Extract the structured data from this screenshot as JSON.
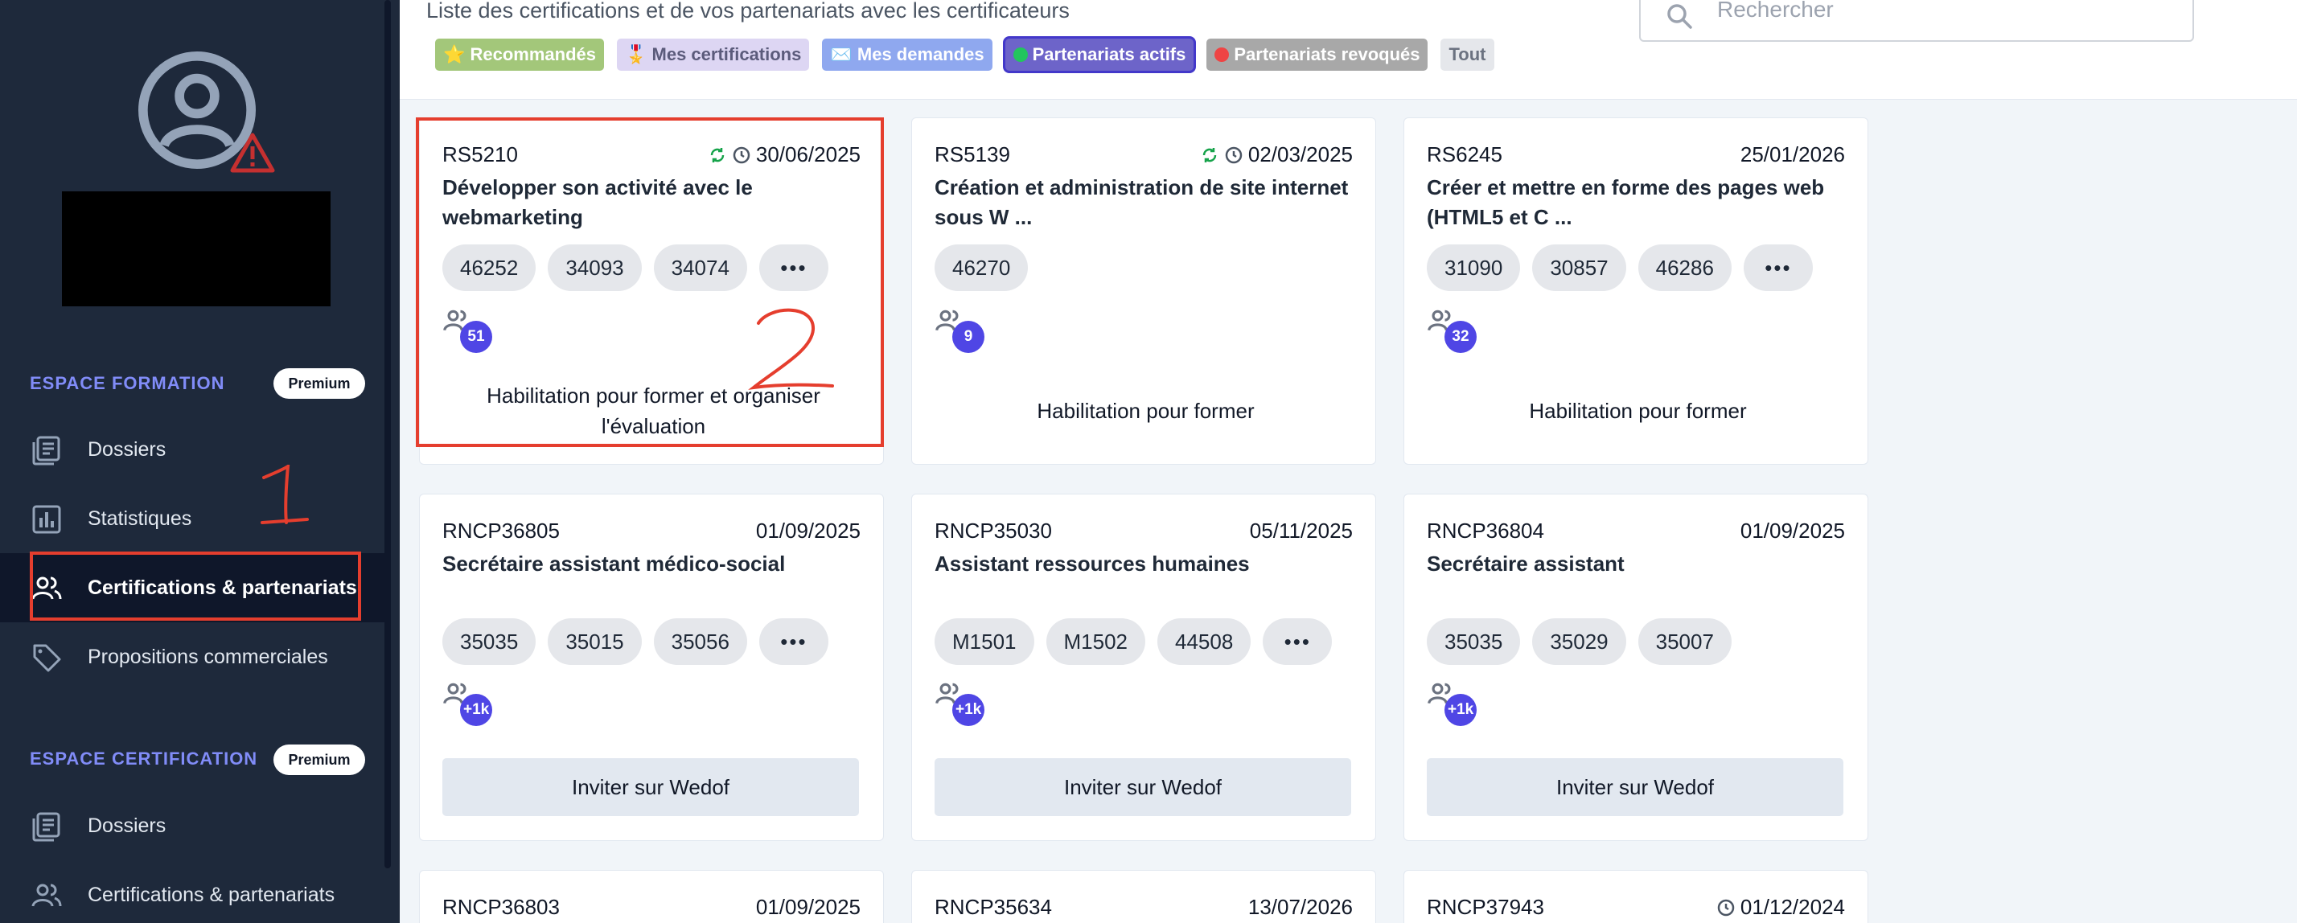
{
  "sidebar": {
    "formation": {
      "title": "ESPACE FORMATION",
      "badge": "Premium",
      "items": [
        {
          "label": "Dossiers",
          "icon": "folder-list-icon"
        },
        {
          "label": "Statistiques",
          "icon": "bar-chart-icon"
        },
        {
          "label": "Certifications & partenariats",
          "icon": "users-icon",
          "active": true
        },
        {
          "label": "Propositions commerciales",
          "icon": "tag-icon"
        }
      ]
    },
    "certification": {
      "title": "ESPACE CERTIFICATION",
      "badge": "Premium",
      "items": [
        {
          "label": "Dossiers",
          "icon": "folder-list-icon"
        },
        {
          "label": "Certifications & partenariats",
          "icon": "users-icon"
        }
      ]
    }
  },
  "header": {
    "subtitle": "Liste des certifications et de vos partenariats avec les certificateurs",
    "search_placeholder": "Rechercher",
    "filters": [
      {
        "label": "⭐ Recommandés",
        "bg": "#a3c77a",
        "color": "#ffffff"
      },
      {
        "label": "🎖️ Mes certifications",
        "bg": "#ddd6f3",
        "color": "#5b5b7b"
      },
      {
        "label": "✉️ Mes demandes",
        "bg": "#8fa8ef",
        "color": "#ffffff"
      },
      {
        "label": "Partenariats actifs",
        "bg": "#6d64c9",
        "color": "#ffffff",
        "dot": "#22c55e",
        "selected": true
      },
      {
        "label": "Partenariats revoqués",
        "bg": "#a8a8a8",
        "color": "#ffffff",
        "dot": "#ef4444"
      },
      {
        "label": "Tout",
        "bg": "#e5e7eb",
        "color": "#6b7280"
      }
    ]
  },
  "cards": [
    {
      "code": "RS5210",
      "date": "30/06/2025",
      "sync": true,
      "clock": true,
      "title": "Développer son activité avec le webmarketing",
      "codes": [
        "46252",
        "34093",
        "34074"
      ],
      "more": true,
      "partners": "51",
      "habilitation": "Habilitation pour former et organiser l'évaluation"
    },
    {
      "code": "RS5139",
      "date": "02/03/2025",
      "sync": true,
      "clock": true,
      "title": "Création et administration de site internet sous W ...",
      "codes": [
        "46270"
      ],
      "more": false,
      "partners": "9",
      "habilitation": "Habilitation pour former"
    },
    {
      "code": "RS6245",
      "date": "25/01/2026",
      "sync": false,
      "clock": false,
      "title": "Créer et mettre en forme des pages web (HTML5 et C ...",
      "codes": [
        "31090",
        "30857",
        "46286"
      ],
      "more": true,
      "partners": "32",
      "habilitation": "Habilitation pour former"
    },
    {
      "code": "RNCP36805",
      "date": "01/09/2025",
      "sync": false,
      "clock": false,
      "title": "Secrétaire assistant médico-social",
      "codes": [
        "35035",
        "35015",
        "35056"
      ],
      "more": true,
      "partners": "+1k",
      "invite": "Inviter sur Wedof"
    },
    {
      "code": "RNCP35030",
      "date": "05/11/2025",
      "sync": false,
      "clock": false,
      "title": "Assistant ressources humaines",
      "codes": [
        "M1501",
        "M1502",
        "44508"
      ],
      "more": true,
      "partners": "+1k",
      "invite": "Inviter sur Wedof"
    },
    {
      "code": "RNCP36804",
      "date": "01/09/2025",
      "sync": false,
      "clock": false,
      "title": "Secrétaire assistant",
      "codes": [
        "35035",
        "35029",
        "35007"
      ],
      "more": false,
      "partners": "+1k",
      "invite": "Inviter sur Wedof"
    },
    {
      "code": "RNCP36803",
      "date": "01/09/2025",
      "sync": false,
      "clock": false
    },
    {
      "code": "RNCP35634",
      "date": "13/07/2026",
      "sync": false,
      "clock": false
    },
    {
      "code": "RNCP37943",
      "date": "01/12/2024",
      "sync": false,
      "clock": true
    }
  ],
  "annotations": {
    "one": "1",
    "two": "2"
  },
  "colors": {
    "accent": "#4f46e5",
    "sidebar": "#1e293b",
    "annotation": "#e53e2e"
  }
}
